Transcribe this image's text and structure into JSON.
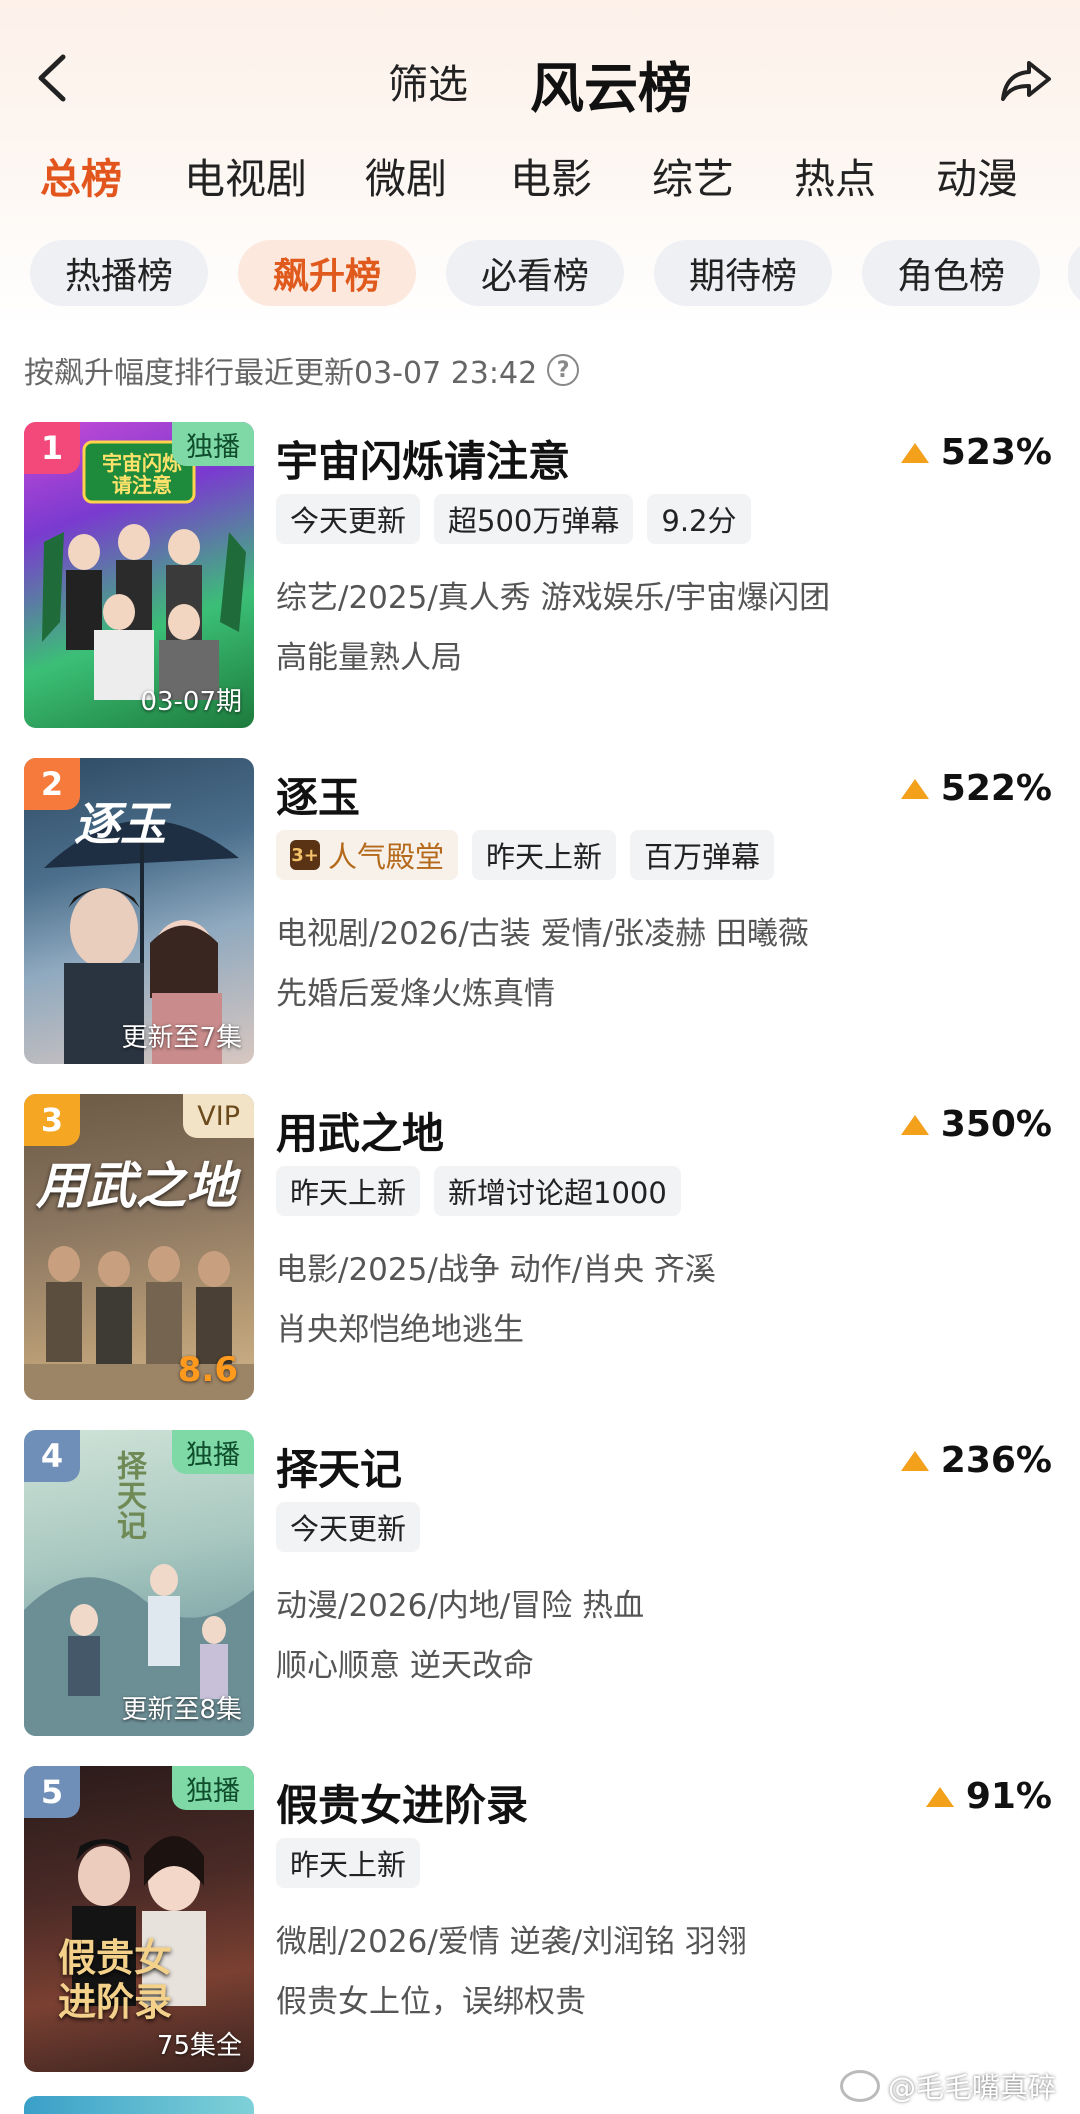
{
  "header": {
    "filter_label": "筛选",
    "title": "风云榜"
  },
  "category_tabs": [
    {
      "label": "总榜",
      "active": true
    },
    {
      "label": "电视剧",
      "active": false
    },
    {
      "label": "微剧",
      "active": false
    },
    {
      "label": "电影",
      "active": false
    },
    {
      "label": "综艺",
      "active": false
    },
    {
      "label": "热点",
      "active": false
    },
    {
      "label": "动漫",
      "active": false
    }
  ],
  "sub_tabs": [
    {
      "label": "热播榜",
      "active": false
    },
    {
      "label": "飙升榜",
      "active": true
    },
    {
      "label": "必看榜",
      "active": false
    },
    {
      "label": "期待榜",
      "active": false
    },
    {
      "label": "角色榜",
      "active": false
    }
  ],
  "sort_note": "按飙升幅度排行最近更新03-07 23:42",
  "accent_color": "#e2561e",
  "items": [
    {
      "rank": "1",
      "rank_color": "#f2497a",
      "badge": "独播",
      "poster_caption": "03-07期",
      "poster_art": "宇宙闪烁\n请注意",
      "title": "宇宙闪烁请注意",
      "change": "523%",
      "chips": [
        "今天更新",
        "超500万弹幕",
        "9.2分"
      ],
      "meta": "综艺/2025/真人秀 游戏娱乐/宇宙爆闪团",
      "desc": "高能量熟人局"
    },
    {
      "rank": "2",
      "rank_color": "#f57a3c",
      "badge": "",
      "poster_caption": "更新至7集",
      "poster_art": "逐玉",
      "title": "逐玉",
      "change": "522%",
      "chips": [
        "人气殿堂",
        "昨天上新",
        "百万弹幕"
      ],
      "meta": "电视剧/2026/古装 爱情/张凌赫 田曦薇",
      "desc": "先婚后爱烽火炼真情"
    },
    {
      "rank": "3",
      "rank_color": "#f5a623",
      "badge": "VIP",
      "poster_caption": "8.6",
      "poster_art": "用武之地",
      "title": "用武之地",
      "change": "350%",
      "chips": [
        "昨天上新",
        "新增讨论超1000"
      ],
      "meta": "电影/2025/战争 动作/肖央 齐溪",
      "desc": "肖央郑恺绝地逃生"
    },
    {
      "rank": "4",
      "rank_color": "#6f8fb8",
      "badge": "独播",
      "poster_caption": "更新至8集",
      "poster_art": "择天记",
      "title": "择天记",
      "change": "236%",
      "chips": [
        "今天更新"
      ],
      "meta": "动漫/2026/内地/冒险 热血",
      "desc": "顺心顺意 逆天改命"
    },
    {
      "rank": "5",
      "rank_color": "#6f8fb8",
      "badge": "独播",
      "poster_caption": "75集全",
      "poster_art": "假贵女\n进阶录",
      "title": "假贵女进阶录",
      "change": "91%",
      "chips": [
        "昨天上新"
      ],
      "meta": "微剧/2026/爱情 逆袭/刘润铭 羽翎",
      "desc": "假贵女上位，误绑权贵"
    }
  ],
  "watermark": "@毛毛嘴真碎"
}
